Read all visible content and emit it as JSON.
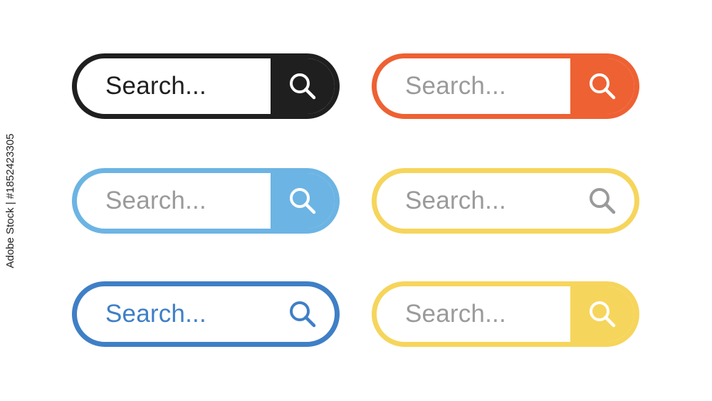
{
  "search_bars": [
    {
      "placeholder": "Search...",
      "border_color": "#1f1f1f",
      "text_color": "#1f1f1f",
      "button_fill": "#1f1f1f",
      "icon_color": "#ffffff",
      "button_style": "filled"
    },
    {
      "placeholder": "Search...",
      "border_color": "#ee6133",
      "text_color": "#9a9a9a",
      "button_fill": "#ee6133",
      "icon_color": "#ffffff",
      "button_style": "filled"
    },
    {
      "placeholder": "Search...",
      "border_color": "#6cb4e4",
      "text_color": "#9a9a9a",
      "button_fill": "#6cb4e4",
      "icon_color": "#ffffff",
      "button_style": "filled"
    },
    {
      "placeholder": "Search...",
      "border_color": "#f6d55c",
      "text_color": "#9a9a9a",
      "button_fill": "",
      "icon_color": "#9a9a9a",
      "button_style": "outline"
    },
    {
      "placeholder": "Search...",
      "border_color": "#3f7fc6",
      "text_color": "#3f7fc6",
      "button_fill": "",
      "icon_color": "#3f7fc6",
      "button_style": "outline"
    },
    {
      "placeholder": "Search...",
      "border_color": "#f6d55c",
      "text_color": "#9a9a9a",
      "button_fill": "#f6d55c",
      "icon_color": "#ffffff",
      "button_style": "filled"
    }
  ],
  "icon": "search-icon",
  "watermark": "Adobe Stock | #1852423305"
}
